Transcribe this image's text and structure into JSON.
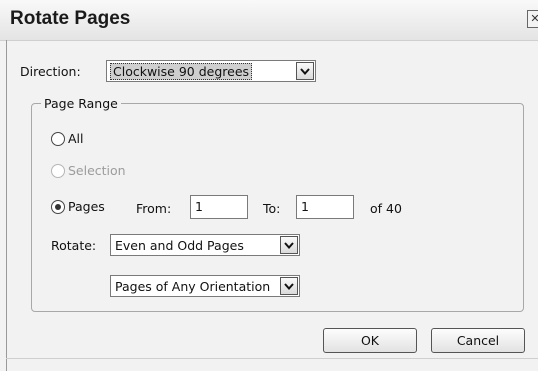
{
  "dialog": {
    "title": "Rotate Pages",
    "close_glyph": "✕"
  },
  "direction": {
    "label": "Direction:",
    "selected": "Clockwise 90 degrees"
  },
  "page_range": {
    "legend": "Page Range",
    "all_label": "All",
    "selection_label": "Selection",
    "pages_label": "Pages",
    "selected_option": "Pages",
    "from_label": "From:",
    "from_value": "1",
    "to_label": "To:",
    "to_value": "1",
    "of_total": "of 40",
    "rotate_label": "Rotate:",
    "rotate_selected": "Even and Odd Pages",
    "orientation_selected": "Pages of Any Orientation"
  },
  "buttons": {
    "ok": "OK",
    "cancel": "Cancel"
  }
}
